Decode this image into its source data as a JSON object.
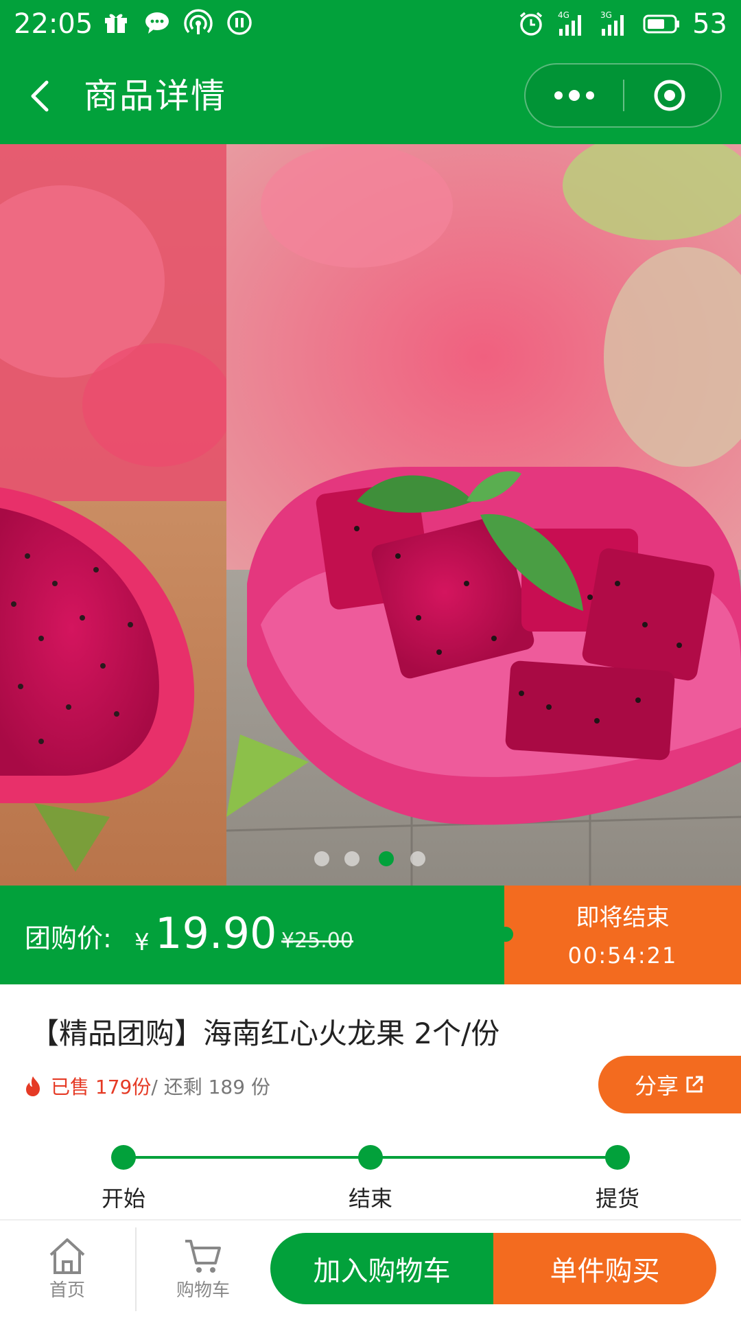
{
  "status_bar": {
    "time": "22:05",
    "left_icons": [
      "gift-icon",
      "wechat-icon",
      "hotspot-icon",
      "pause-icon"
    ],
    "right_icons": [
      "alarm-icon",
      "signal-4g-icon",
      "signal-3g-icon",
      "battery-icon"
    ],
    "network_4g": "4G",
    "network_3g": "3G",
    "battery_percent": "53"
  },
  "nav": {
    "title": "商品详情",
    "back_icon": "back-chevron-icon",
    "more_icon": "more-dots-icon",
    "close_icon": "target-close-icon"
  },
  "carousel": {
    "image_count": 4,
    "active_index": 2
  },
  "price": {
    "label": "团购价:",
    "currency": "¥",
    "value": "19.90",
    "original": "¥25.00",
    "ending_label": "即将结束",
    "countdown": "00:54:21"
  },
  "product": {
    "title": "【精品团购】海南红心火龙果 2个/份",
    "sold_text": "已售 179份",
    "remaining_text": "/ 还剩 189 份",
    "share_label": "分享"
  },
  "steps": [
    {
      "label": "开始"
    },
    {
      "label": "结束"
    },
    {
      "label": "提货"
    }
  ],
  "bottom_bar": {
    "home_label": "首页",
    "cart_label": "购物车",
    "add_cart_button": "加入购物车",
    "buy_button": "单件购买"
  },
  "colors": {
    "brand_green": "#02a13b",
    "accent_orange": "#f36b1f",
    "sold_red": "#e53a25"
  }
}
